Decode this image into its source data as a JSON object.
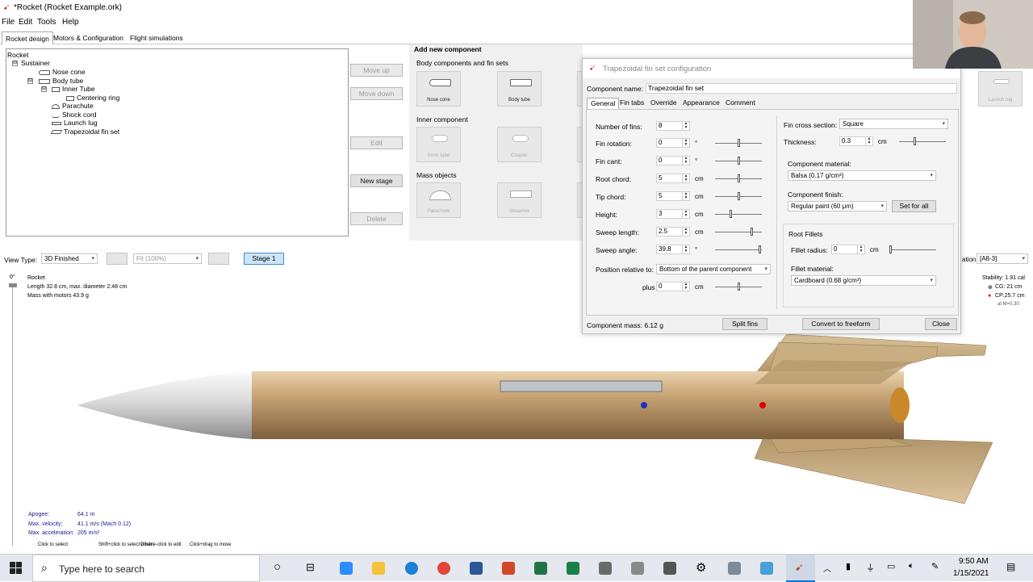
{
  "window": {
    "title": "*Rocket (Rocket Example.ork)"
  },
  "menu": [
    "File",
    "Edit",
    "Tools",
    "Help"
  ],
  "main_tabs": [
    "Rocket design",
    "Motors & Configuration",
    "Flight simulations"
  ],
  "tree": {
    "items": [
      "Rocket",
      "Sustainer",
      "Nose cone",
      "Body tube",
      "Inner Tube",
      "Centering ring",
      "Parachute",
      "Shock cord",
      "Launch lug",
      "Trapezoidal fin set"
    ],
    "expanders": [
      "⊟",
      "⊟",
      "⊟"
    ]
  },
  "side_buttons": {
    "move_up": "Move up",
    "move_down": "Move down",
    "edit": "Edit",
    "new_stage": "New stage",
    "delete": "Delete"
  },
  "add_component": {
    "title": "Add new component",
    "body_section": "Body components and fin sets",
    "body_items": [
      "Nose cone",
      "Body tube"
    ],
    "inner_section": "Inner component",
    "inner_items": [
      "Inner tube",
      "Coupler"
    ],
    "mass_section": "Mass objects",
    "mass_items": [
      "Parachute",
      "Streamer"
    ],
    "far_right_item": "Launch lug"
  },
  "dialog": {
    "title": "Trapezoidal fin set configuration",
    "name_label": "Component name:",
    "name_value": "Trapezoidal fin set",
    "tabs": [
      "General",
      "Fin tabs",
      "Override",
      "Appearance",
      "Comment"
    ],
    "fields": [
      {
        "label": "Number of fins:",
        "value": "8",
        "unit": ""
      },
      {
        "label": "Fin rotation:",
        "value": "0",
        "unit": "°"
      },
      {
        "label": "Fin cant:",
        "value": "0",
        "unit": "°"
      },
      {
        "label": "Root chord:",
        "value": "5",
        "unit": "cm"
      },
      {
        "label": "Tip chord:",
        "value": "5",
        "unit": "cm"
      },
      {
        "label": "Height:",
        "value": "3",
        "unit": "cm"
      },
      {
        "label": "Sweep length:",
        "value": "2.5",
        "unit": "cm"
      },
      {
        "label": "Sweep angle:",
        "value": "39.8",
        "unit": "°"
      }
    ],
    "position_label": "Position relative to:",
    "position_value": "Bottom of the parent component",
    "plus_label": "plus",
    "plus_value": "0",
    "plus_unit": "cm",
    "cross_section_label": "Fin cross section:",
    "cross_section_value": "Square",
    "thickness_label": "Thickness:",
    "thickness_value": "0.3",
    "thickness_unit": "cm",
    "material_label": "Component material:",
    "material_value": "Balsa (0.17 g/cm³)",
    "finish_label": "Component finish:",
    "finish_value": "Regular paint (60 μm)",
    "set_for_all": "Set for all",
    "root_fillets_label": "Root Fillets",
    "fillet_radius_label": "Fillet radius:",
    "fillet_radius_value": "0",
    "fillet_radius_unit": "cm",
    "fillet_material_label": "Fillet material:",
    "fillet_material_value": "Cardboard (0.68 g/cm³)",
    "mass_text": "Component mass: 6.12 g",
    "split_fins": "Split fins",
    "convert": "Convert to freeform",
    "close": "Close"
  },
  "viewbar": {
    "view_type_label": "View Type:",
    "view_type_value": "3D Finished",
    "zoom_value": "Fit (100%)",
    "stage_button": "Stage 1",
    "config_label": "ation:",
    "config_value": "[A8-3]"
  },
  "view": {
    "angle": "0°",
    "rocket_name": "Rocket",
    "length_text": "Length 32.8 cm, max. diameter 2.48 cm",
    "mass_text": "Mass with motors 43.9 g",
    "stability": "Stability: 1.91 cal",
    "cg": "CG:  21 cm",
    "cp": "CP:25.7 cm",
    "mach": "at M=0.30",
    "apogee_label": "Apogee:",
    "apogee_value": "64.1 m",
    "velocity_label": "Max. velocity:",
    "velocity_value": "41.1 m/s  (Mach 0.12)",
    "accel_label": "Max. acceleration:",
    "accel_value": "205 m/s²",
    "hints": [
      "Click to select",
      "Shift+click to select other",
      "Double-click to edit",
      "Click+drag to move"
    ]
  },
  "taskbar": {
    "search_placeholder": "Type here to search",
    "time": "9:50 AM",
    "date": "1/15/2021"
  },
  "colors": {
    "accent": "#0078d7",
    "tube": "#c9a577",
    "nose": "#e8e8e8",
    "fin": "#d4b98c",
    "cp_dot": "#e00000",
    "cg_dot": "#2030c0"
  }
}
